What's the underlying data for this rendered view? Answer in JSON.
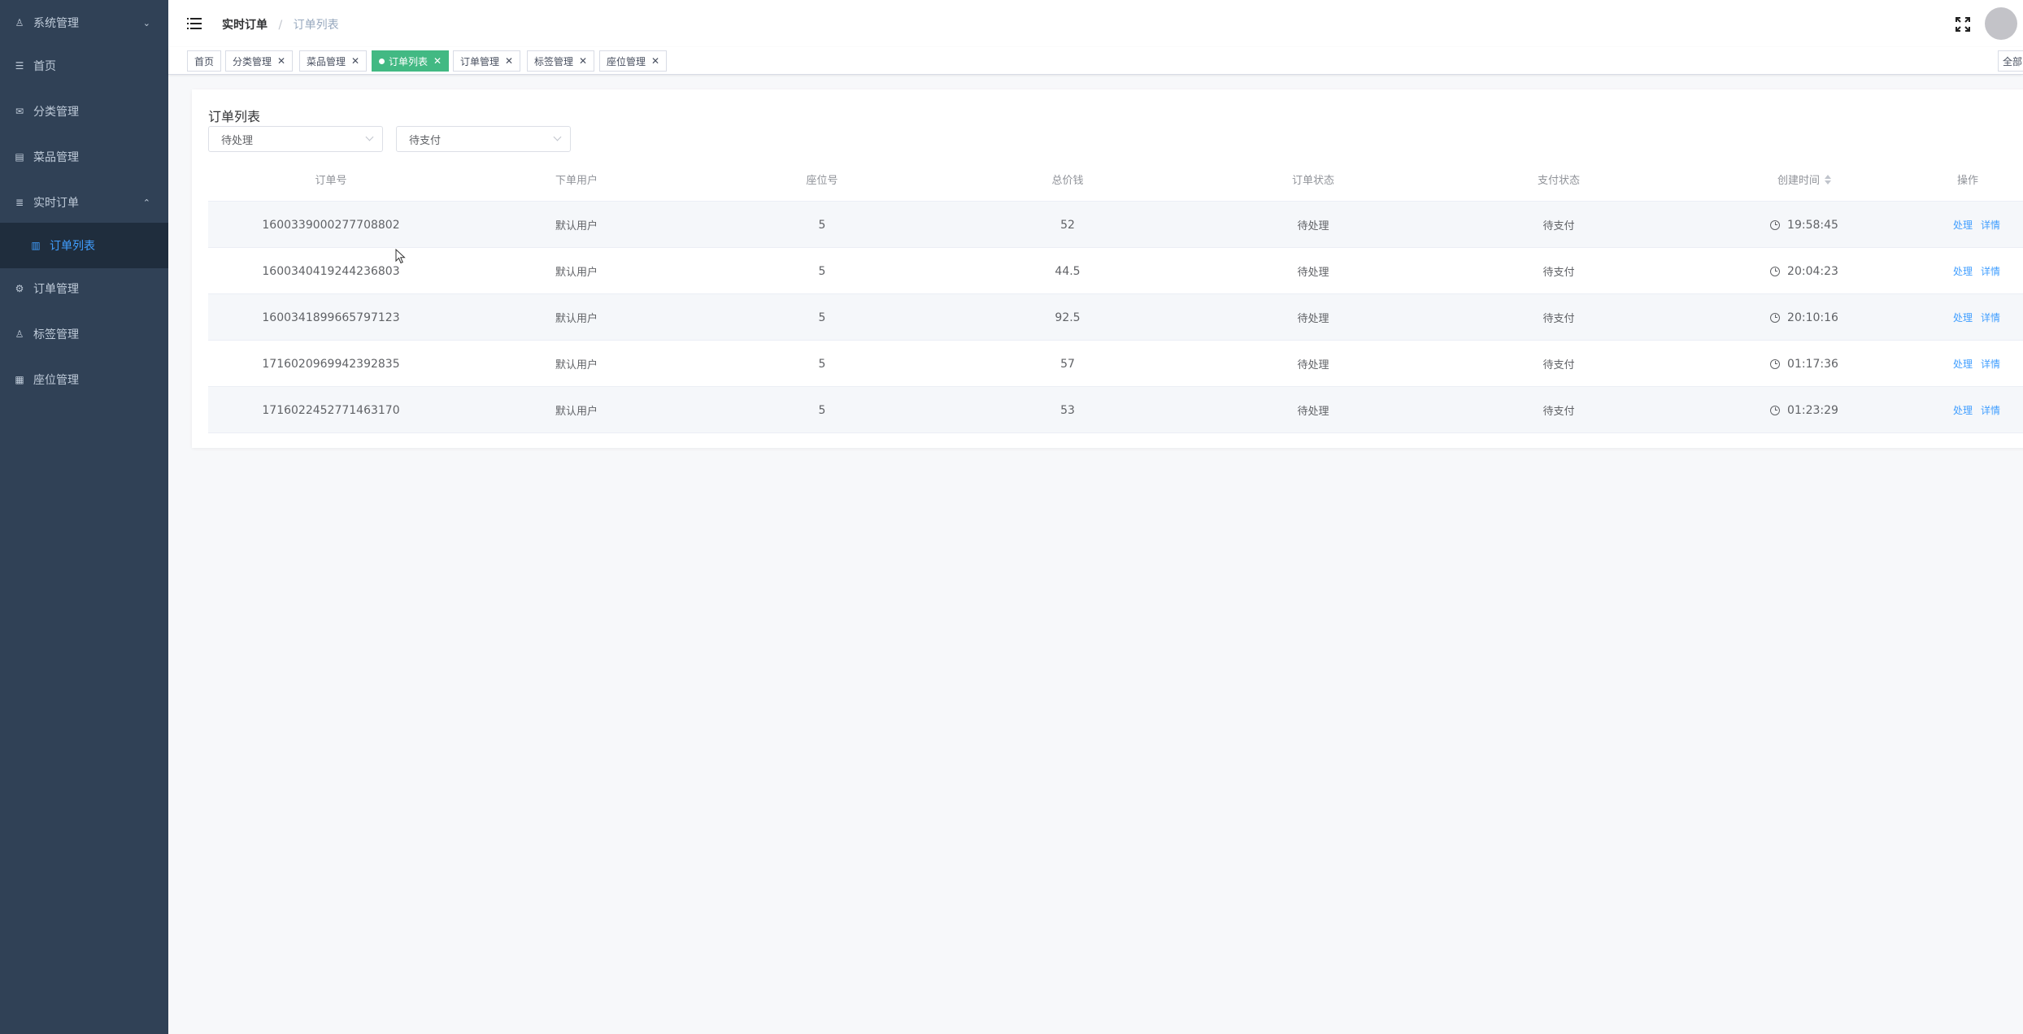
{
  "sidebar": {
    "items": [
      {
        "label": "系统管理",
        "icon": "user-icon",
        "arrow": "chevron-down"
      },
      {
        "label": "首页",
        "icon": "list-icon"
      },
      {
        "label": "分类管理",
        "icon": "mail-icon"
      },
      {
        "label": "菜品管理",
        "icon": "card-icon"
      },
      {
        "label": "实时订单",
        "icon": "menu-icon",
        "arrow": "chevron-up"
      },
      {
        "label": "订单列表",
        "icon": "chart-icon",
        "active": true
      },
      {
        "label": "订单管理",
        "icon": "settings-icon"
      },
      {
        "label": "标签管理",
        "icon": "user-icon"
      },
      {
        "label": "座位管理",
        "icon": "book-icon"
      }
    ]
  },
  "header": {
    "breadcrumb": [
      "实时订单",
      "订单列表"
    ],
    "separator": "/"
  },
  "tags": [
    {
      "label": "首页",
      "closable": false
    },
    {
      "label": "分类管理",
      "closable": true
    },
    {
      "label": "菜品管理",
      "closable": true
    },
    {
      "label": "订单列表",
      "closable": true,
      "active": true
    },
    {
      "label": "订单管理",
      "closable": true
    },
    {
      "label": "标签管理",
      "closable": true
    },
    {
      "label": "座位管理",
      "closable": true
    }
  ],
  "tag_all": "全部",
  "card": {
    "title": "订单列表",
    "filters": [
      {
        "value": "待处理"
      },
      {
        "value": "待支付"
      }
    ]
  },
  "table": {
    "columns": [
      "订单号",
      "下单用户",
      "座位号",
      "总价钱",
      "订单状态",
      "支付状态",
      "创建时间",
      "操作"
    ],
    "rows": [
      {
        "order_no": "1600339000277708802",
        "user": "默认用户",
        "seat": "5",
        "price": "52",
        "status": "待处理",
        "pay": "待支付",
        "time": "19:58:45"
      },
      {
        "order_no": "1600340419244236803",
        "user": "默认用户",
        "seat": "5",
        "price": "44.5",
        "status": "待处理",
        "pay": "待支付",
        "time": "20:04:23"
      },
      {
        "order_no": "1600341899665797123",
        "user": "默认用户",
        "seat": "5",
        "price": "92.5",
        "status": "待处理",
        "pay": "待支付",
        "time": "20:10:16"
      },
      {
        "order_no": "1716020969942392835",
        "user": "默认用户",
        "seat": "5",
        "price": "57",
        "status": "待处理",
        "pay": "待支付",
        "time": "01:17:36"
      },
      {
        "order_no": "1716022452771463170",
        "user": "默认用户",
        "seat": "5",
        "price": "53",
        "status": "待处理",
        "pay": "待支付",
        "time": "01:23:29"
      }
    ],
    "actions": [
      "处理",
      "详情"
    ]
  },
  "colors": {
    "sidebar_bg": "#304156",
    "active_link": "#409eff",
    "active_tag": "#42b983"
  }
}
